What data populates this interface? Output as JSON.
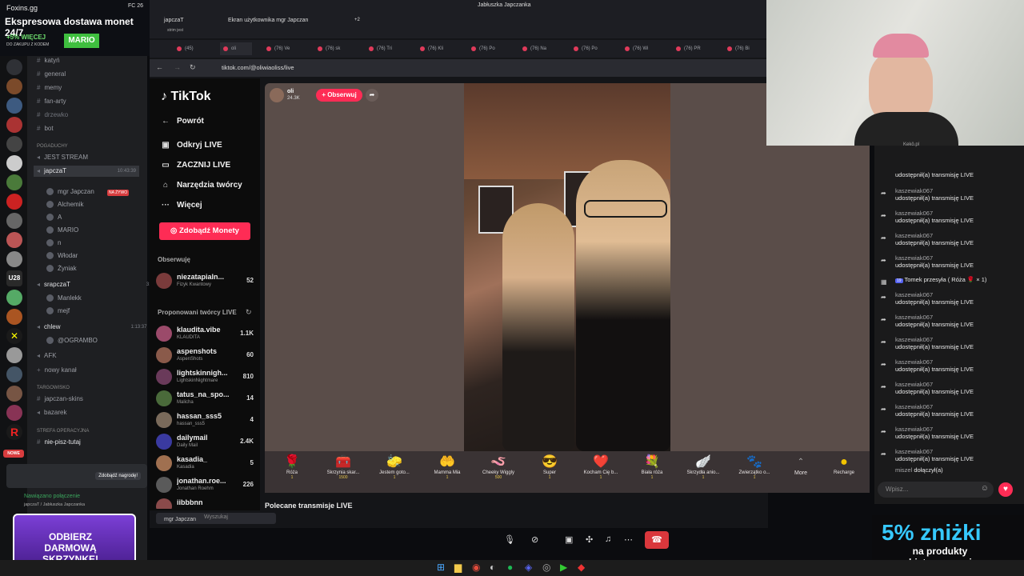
{
  "promo": {
    "site": "Foxins.gg",
    "headline": "Ekspresowa dostawa monet 24/7",
    "bonus": "+5% WIĘCEJ",
    "bonus_sub": "DO ZAKUPU Z KODEM",
    "code": "MARIO",
    "bottom_banner": "ODBIERZ DARMOWĄ SKRZYNKĘ!"
  },
  "discord": {
    "channels": [
      {
        "name": "katyń",
        "type": "text"
      },
      {
        "name": "general",
        "type": "text"
      },
      {
        "name": "memy",
        "type": "text"
      },
      {
        "name": "fan-arty",
        "type": "text"
      },
      {
        "name": "drzewko",
        "type": "text"
      },
      {
        "name": "bot",
        "type": "text"
      }
    ],
    "category_1": "POGADUCHY",
    "stream_channel": "JEST STREAM",
    "voice_channel": "japczaT",
    "voice_time": "10:43:39",
    "voice_users": [
      "mgr Japczan",
      "Alchemik",
      "A",
      "MARIO",
      "n",
      "Włodar",
      "Żyniak"
    ],
    "live_badge": "NA ŻYWO",
    "voice2": "srapczaT",
    "voice2_time": "31:28",
    "voice2_users": [
      "Manlekk",
      "mejf"
    ],
    "voice3": "chlew",
    "voice3_time": "1:13:37",
    "voice3_users": [
      "@OGRAMBO"
    ],
    "afk": "AFK",
    "new_channel": "nowy kanał",
    "category_2": "TARGOWISKO",
    "market_1": "japczan-skins",
    "market_2": "bazarek",
    "category_3": "STREFA OPERACYJNA",
    "no_write": "nie-pisz-tutaj",
    "connected": "Nawiązano połączenie",
    "connected_sub": "japczaT / Jabłuszka Japczanka",
    "reward": "Zdobądź nagrodę!",
    "new_label": "NOWE"
  },
  "window": {
    "title": "Jabłuszka Japczanka",
    "fc": "FC 26",
    "share_user": "japczaT",
    "share_text": "Ekran użytkownika mgr Japczan",
    "share_extra": "+2",
    "stream_sub": "strim jest"
  },
  "browser": {
    "url": "tiktok.com/@oliwiaoliss/live",
    "tabs": [
      "(45)",
      "oli",
      "(76) Ve",
      "(76) sk",
      "(76) Tri",
      "(76) Kli",
      "(76) Po",
      "(76) Na",
      "(76) Po",
      "(76) Wi",
      "(76) PR",
      "(76) Bi"
    ]
  },
  "tiktok": {
    "logo": "TikTok",
    "back": "Powrót",
    "nav": [
      "Odkryj LIVE",
      "ZACZNIJ LIVE",
      "Narzędzia twórcy",
      "Więcej"
    ],
    "coins_button": "Zdobądź Monety",
    "following_header": "Obserwuję",
    "following": [
      {
        "name": "niezatapialn...",
        "sub": "Fizyk Kwantowy",
        "count": "52"
      }
    ],
    "suggested_header": "Proponowani twórcy LIVE",
    "suggested": [
      {
        "name": "klaudita.vibe",
        "sub": "KLAUDITA",
        "count": "1.1K"
      },
      {
        "name": "aspenshots",
        "sub": "AspenShots",
        "count": "60"
      },
      {
        "name": "lightskinnigh...",
        "sub": "LightskinNightmare",
        "count": "810"
      },
      {
        "name": "tatus_na_spo...",
        "sub": "Malicha",
        "count": "14"
      },
      {
        "name": "hassan_sss5",
        "sub": "hassan_sss5",
        "count": "4"
      },
      {
        "name": "dailymail",
        "sub": "Daily Mail",
        "count": "2.4K"
      },
      {
        "name": "kasadia_",
        "sub": "Kasadia",
        "count": "5"
      },
      {
        "name": "jonathan.roe...",
        "sub": "Jonathan Roehm",
        "count": "226"
      },
      {
        "name": "iibbbnn",
        "sub": "",
        "count": ""
      }
    ],
    "host_name": "oli",
    "host_viewers": "24.3K",
    "follow": "+ Obserwuj",
    "recommended": "Polecane transmisje LIVE",
    "gifts": [
      {
        "icon": "🌹",
        "name": "Róża",
        "price": "1"
      },
      {
        "icon": "🧰",
        "name": "Skrzynia skar...",
        "price": "1500"
      },
      {
        "icon": "🧽",
        "name": "Jestem goto...",
        "price": "1"
      },
      {
        "icon": "🤲",
        "name": "Mamma Mia",
        "price": "1"
      },
      {
        "icon": "🪱",
        "name": "Cheeky Wiggly",
        "price": "500"
      },
      {
        "icon": "😎",
        "name": "Super",
        "price": "1"
      },
      {
        "icon": "❤️",
        "name": "Kocham Cię b...",
        "price": "1"
      },
      {
        "icon": "💐",
        "name": "Biała róża",
        "price": "1"
      },
      {
        "icon": "🪽",
        "name": "Skrzydła anio...",
        "price": "1"
      },
      {
        "icon": "🐾",
        "name": "Zwierzątko o...",
        "price": "1"
      }
    ],
    "more": "More",
    "recharge": "Recharge"
  },
  "chat": {
    "top_user": "Kekö.pl",
    "messages": [
      {
        "user": "",
        "text": "udostępnił(a) transmisję LIVE"
      },
      {
        "user": "kaszewiak067",
        "text": "udostępnił(a) transmisję LIVE"
      },
      {
        "user": "kaszewiak067",
        "text": "udostępnił(a) transmisję LIVE"
      },
      {
        "user": "kaszewiak067",
        "text": "udostępnił(a) transmisję LIVE"
      },
      {
        "user": "kaszewiak067",
        "text": "udostępnił(a) transmisję LIVE"
      },
      {
        "user": "kaszewiak067",
        "text": "udostępnił(a) transmisję LIVE"
      },
      {
        "user": "kaszewiak067",
        "text": "udostępnił(a) transmisję LIVE"
      },
      {
        "user": "kaszewiak067",
        "text": "udostępnił(a) transmisję LIVE"
      },
      {
        "user": "kaszewiak067",
        "text": "udostępnił(a) transmisję LIVE"
      },
      {
        "user": "kaszewiak067",
        "text": "udostępnił(a) transmisję LIVE"
      },
      {
        "user": "kaszewiak067",
        "text": "udostępnił(a) transmisję LIVE"
      }
    ],
    "gift_msg_level": "19",
    "gift_msg": "Tomek przesyła ( Róża 🌹 × 1)",
    "joined_user": "miszel",
    "joined_text": "dołączył(a)",
    "placeholder": "Wpisz..."
  },
  "screenshare": {
    "search": "Wyszukaj",
    "user": "mgr Japczan"
  },
  "promo2": {
    "big": "5% zniżki",
    "sub1": "na produkty",
    "sub2": "objęte promocją"
  }
}
